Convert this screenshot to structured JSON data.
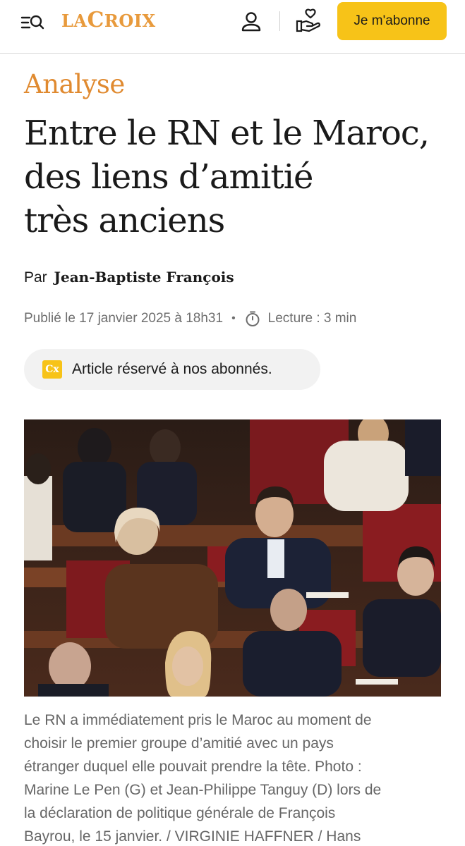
{
  "header": {
    "logo_small_1": "LA",
    "logo_big": "C",
    "logo_small_2": "ROIX",
    "subscribe_label": "Je m'abonne",
    "icons": [
      "menu-search-icon",
      "account-icon",
      "gift-heart-icon"
    ],
    "accent_color": "#f7c318",
    "brand_color": "#e89a3c"
  },
  "article": {
    "kicker": "Analyse",
    "title_lines": [
      "Entre le RN et le Maroc,",
      "des liens d’amitié",
      "très anciens"
    ],
    "byline_prefix": "Par",
    "author": "Jean-Baptiste François",
    "published": "Publié le 17 janvier 2025 à 18h31",
    "separator": "•",
    "reading_time": "Lecture : 3 min",
    "premium_badge": "Cx",
    "premium_text": "Article réservé à nos abonnés.",
    "caption_lines": [
      "Le RN a immédiatement pris le Maroc au moment de",
      "choisir le premier groupe d’amitié avec un pays",
      "étranger duquel elle pouvait prendre la tête. Photo :",
      "Marine Le Pen (G) et Jean-Philippe Tanguy (D) lors de",
      "la déclaration de politique générale de François",
      "Bayrou, le 15 janvier. / VIRGINIE HAFFNER / Hans"
    ]
  }
}
